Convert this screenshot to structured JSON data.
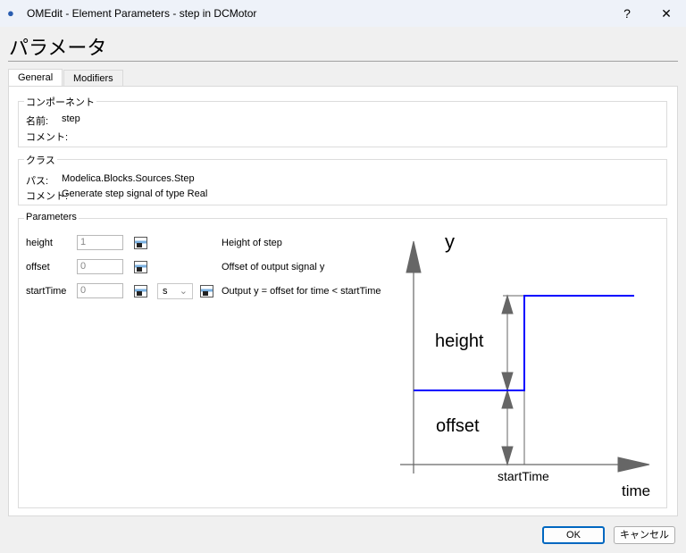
{
  "window": {
    "title": "OMEdit - Element Parameters - step in DCMotor",
    "help": "?",
    "close": "✕"
  },
  "heading": "パラメータ",
  "tabs": [
    {
      "label": "General"
    },
    {
      "label": "Modifiers"
    }
  ],
  "component": {
    "title": "コンポーネント",
    "name_label": "名前:",
    "name_value": "step",
    "comment_label": "コメント:",
    "comment_value": ""
  },
  "class": {
    "title": "クラス",
    "path_label": "パス:",
    "path_value": "Modelica.Blocks.Sources.Step",
    "comment_label": "コメント:",
    "comment_value": "Generate step signal of type Real"
  },
  "parameters": {
    "title": "Parameters",
    "rows": [
      {
        "name": "height",
        "value": "1",
        "description": "Height of step"
      },
      {
        "name": "offset",
        "value": "0",
        "description": "Offset of output signal y"
      },
      {
        "name": "startTime",
        "value": "0",
        "unit": "s",
        "description": "Output y = offset for time < startTime"
      }
    ]
  },
  "diagram": {
    "y_label": "y",
    "height_label": "height",
    "offset_label": "offset",
    "start_label": "startTime",
    "time_label": "time",
    "line_color": "#0000ff"
  },
  "buttons": {
    "ok": "OK",
    "cancel": "キャンセル"
  }
}
